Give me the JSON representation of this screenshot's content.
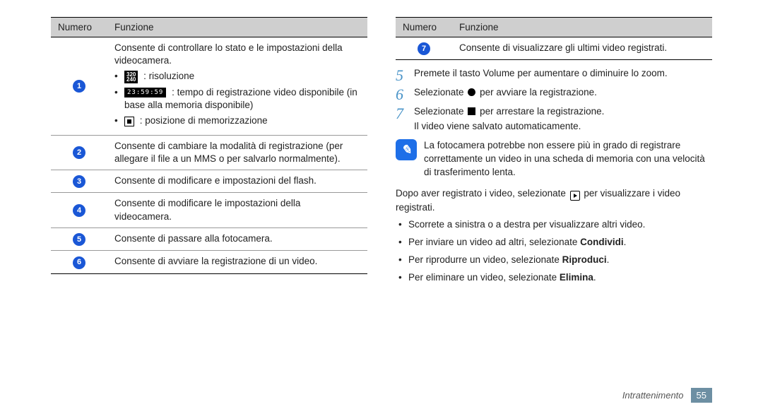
{
  "table_header": {
    "numero": "Numero",
    "funzione": "Funzione"
  },
  "left_rows": [
    {
      "num": "1",
      "intro": "Consente di controllare lo stato e le impostazioni della videocamera.",
      "items": [
        {
          "icon": "res",
          "icon_text": "320\n240",
          "text": ": risoluzione"
        },
        {
          "icon": "timer",
          "icon_text": "23:59:59",
          "text": ": tempo di registrazione video disponibile (in base alla memoria disponibile)"
        },
        {
          "icon": "storage",
          "text": ": posizione di memorizzazione"
        }
      ]
    },
    {
      "num": "2",
      "text": "Consente di cambiare la modalità di registrazione (per allegare il file a un MMS o per salvarlo normalmente)."
    },
    {
      "num": "3",
      "text": "Consente di modificare e impostazioni del flash."
    },
    {
      "num": "4",
      "text": "Consente di modificare le impostazioni della videocamera."
    },
    {
      "num": "5",
      "text": "Consente di passare alla fotocamera."
    },
    {
      "num": "6",
      "text": "Consente di avviare la registrazione di un video."
    }
  ],
  "right_rows": [
    {
      "num": "7",
      "text": "Consente di visualizzare gli ultimi video registrati."
    }
  ],
  "steps": {
    "s5": "Premete il tasto Volume per aumentare o diminuire lo zoom.",
    "s6_pre": "Selezionate ",
    "s6_post": " per avviare la registrazione.",
    "s7_pre": "Selezionate ",
    "s7_post": " per arrestare la registrazione.",
    "s7_sub": "Il video viene salvato automaticamente."
  },
  "note": "La fotocamera potrebbe non essere più in grado di registrare correttamente un video in una scheda di memoria con una velocità di trasferimento lenta.",
  "after_note_pre": "Dopo aver registrato i video, selezionate ",
  "after_note_post": " per visualizzare i video registrati.",
  "bullets": [
    {
      "plain": "Scorrete a sinistra o a destra per visualizzare altri video."
    },
    {
      "pre": "Per inviare un video ad altri, selezionate ",
      "bold": "Condividi",
      "post": "."
    },
    {
      "pre": "Per riprodurre un video, selezionate ",
      "bold": "Riproduci",
      "post": "."
    },
    {
      "pre": "Per eliminare un video, selezionate ",
      "bold": "Elimina",
      "post": "."
    }
  ],
  "footer": {
    "section": "Intrattenimento",
    "page": "55"
  }
}
